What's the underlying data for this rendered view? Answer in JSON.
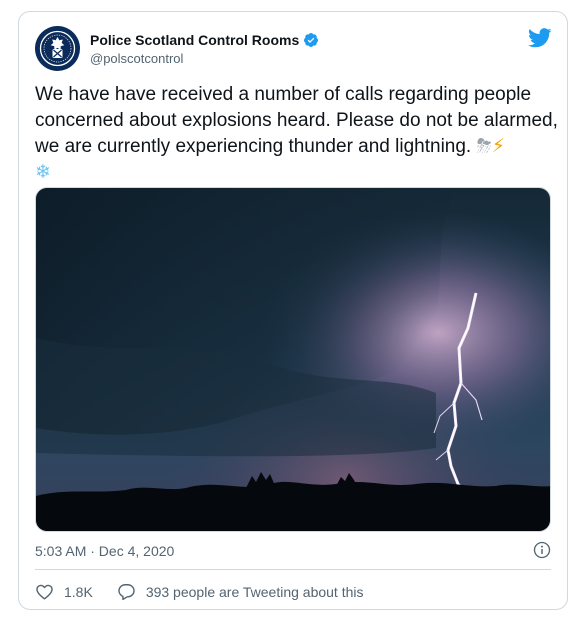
{
  "account": {
    "display_name": "Police Scotland Control Rooms",
    "handle": "@polscotcontrol",
    "verified": true,
    "avatar_icon": "police-scotland-crest"
  },
  "tweet": {
    "text": "We have have received a number of calls regarding people concerned about explosions heard. Please do not be alarmed, we are currently experiencing thunder and lightning.",
    "emojis": [
      "cloud-with-lightning-and-rain",
      "high-voltage",
      "snowflake"
    ],
    "media_icon": "thunderstorm-lightning-photo",
    "timestamp": "5:03 AM · Dec 4, 2020"
  },
  "actions": {
    "likes_count": "1.8K",
    "conversation_label": "393 people are Tweeting about this"
  },
  "colors": {
    "twitter_blue": "#1d9bf0",
    "text_primary": "#0f1419",
    "text_secondary": "#536471",
    "border": "#cfd9de",
    "crest_navy": "#0b2c5a"
  }
}
